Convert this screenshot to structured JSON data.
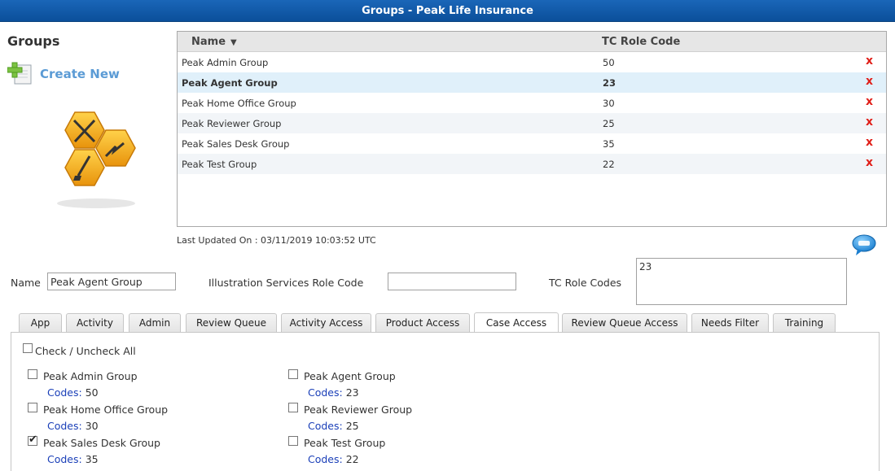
{
  "window": {
    "title": "Groups - Peak Life Insurance"
  },
  "sidebar": {
    "heading": "Groups",
    "create_new_label": "Create New"
  },
  "grid": {
    "columns": {
      "name": "Name",
      "sort_indicator": "▼",
      "code": "TC Role Code"
    },
    "rows": [
      {
        "name": "Peak Admin Group",
        "code": "50",
        "delete": "x"
      },
      {
        "name": "Peak Agent Group",
        "code": "23",
        "delete": "x"
      },
      {
        "name": "Peak Home Office Group",
        "code": "30",
        "delete": "x"
      },
      {
        "name": "Peak Reviewer Group",
        "code": "25",
        "delete": "x"
      },
      {
        "name": "Peak Sales Desk Group",
        "code": "35",
        "delete": "x"
      },
      {
        "name": "Peak Test Group",
        "code": "22",
        "delete": "x"
      }
    ],
    "selected_row": "Peak Agent Group"
  },
  "last_updated": "Last Updated On : 03/11/2019 10:03:52 UTC",
  "form": {
    "name_label": "Name",
    "name_value": "Peak Agent Group",
    "illustration_label": "Illustration Services Role Code",
    "illustration_value": "",
    "tc_codes_label": "TC Role Codes",
    "tc_codes_value": "23"
  },
  "tabs": [
    {
      "label": "App"
    },
    {
      "label": "Activity"
    },
    {
      "label": "Admin"
    },
    {
      "label": "Review Queue"
    },
    {
      "label": "Activity Access"
    },
    {
      "label": "Product Access"
    },
    {
      "label": "Case Access",
      "active": true
    },
    {
      "label": "Review Queue Access"
    },
    {
      "label": "Needs Filter"
    },
    {
      "label": "Training"
    }
  ],
  "case_access": {
    "check_all_label": "Check / Uncheck All",
    "codes_label": "Codes:",
    "groups": [
      {
        "name": "Peak Admin Group",
        "codes": "50",
        "checked": false
      },
      {
        "name": "Peak Agent Group",
        "codes": "23",
        "checked": false
      },
      {
        "name": "Peak Home Office Group",
        "codes": "30",
        "checked": false
      },
      {
        "name": "Peak Reviewer Group",
        "codes": "25",
        "checked": false
      },
      {
        "name": "Peak Sales Desk Group",
        "codes": "35",
        "checked": true
      },
      {
        "name": "Peak Test Group",
        "codes": "22",
        "checked": false
      }
    ]
  },
  "icons": {
    "create_new": "add-document-icon",
    "logo": "tools-honeycomb-logo",
    "chat": "chat-bubble-icon",
    "delete": "delete-x-icon",
    "check": "checkmark-icon"
  },
  "colors": {
    "titlebar": "#0f5aa8",
    "link": "#5b9bd5",
    "delete": "#e0201a",
    "codes_key": "#1a3fb8",
    "selected_row": "#e0f0fa"
  }
}
